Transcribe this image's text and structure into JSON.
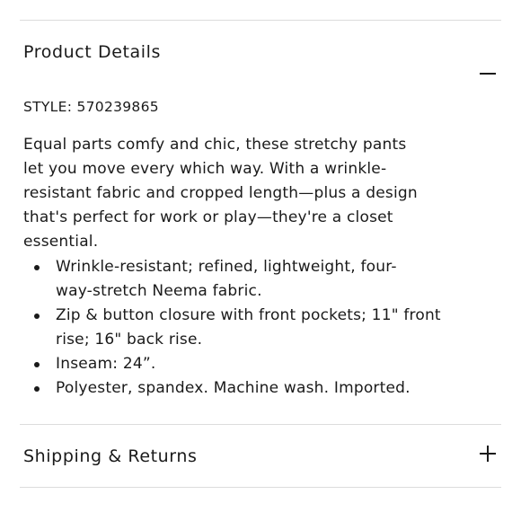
{
  "product_details": {
    "title": "Product Details",
    "toggle_icon": "minus-icon",
    "style_line": "STYLE: 570239865",
    "description_lines": [
      "Equal parts comfy and chic, these stretchy pants",
      "let you move every which way. With a wrinkle-",
      "resistant fabric and cropped length—plus a design",
      "that's perfect for work or play—they're a closet",
      "essential."
    ],
    "features": [
      {
        "lines": [
          "Wrinkle-resistant; refined, lightweight, four-",
          "way-stretch Neema fabric."
        ]
      },
      {
        "lines": [
          "Zip & button closure with front pockets; 11\" front",
          "rise; 16\" back rise."
        ]
      },
      {
        "lines": [
          "Inseam: 24”."
        ]
      },
      {
        "lines": [
          "Polyester, spandex. Machine wash. Imported."
        ]
      }
    ]
  },
  "shipping_returns": {
    "title": "Shipping & Returns",
    "toggle_icon": "plus-icon"
  }
}
